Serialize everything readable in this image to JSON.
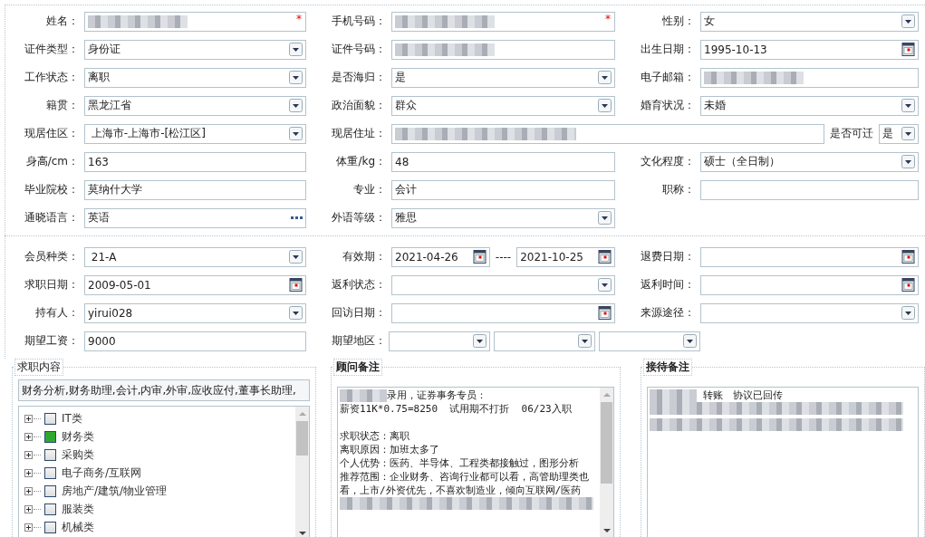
{
  "basic_info": {
    "rows": [
      [
        {
          "label": "姓名：",
          "control": {
            "kind": "text",
            "redacted": true,
            "required_mark": "*"
          }
        },
        {
          "label": "手机号码：",
          "control": {
            "kind": "text",
            "redacted": true,
            "required_mark": "*"
          }
        },
        {
          "label": "性别：",
          "control": {
            "kind": "select",
            "value": "女"
          }
        }
      ],
      [
        {
          "label": "证件类型：",
          "control": {
            "kind": "select",
            "value": "身份证"
          }
        },
        {
          "label": "证件号码：",
          "control": {
            "kind": "text",
            "redacted": true
          }
        },
        {
          "label": "出生日期：",
          "control": {
            "kind": "date",
            "value": "1995-10-13"
          }
        }
      ],
      [
        {
          "label": "工作状态：",
          "control": {
            "kind": "select",
            "value": "离职"
          }
        },
        {
          "label": "是否海归：",
          "control": {
            "kind": "select",
            "value": "是"
          }
        },
        {
          "label": "电子邮箱：",
          "control": {
            "kind": "text",
            "redacted": true
          }
        }
      ],
      [
        {
          "label": "籍贯：",
          "control": {
            "kind": "select",
            "value": "黑龙江省"
          }
        },
        {
          "label": "政治面貌：",
          "control": {
            "kind": "select",
            "value": "群众"
          }
        },
        {
          "label": "婚育状况：",
          "control": {
            "kind": "select",
            "value": "未婚"
          }
        }
      ],
      [
        {
          "label": "现居住区：",
          "control": {
            "kind": "select",
            "value": " 上海市-上海市-[松江区]"
          }
        },
        {
          "label": "现居住址：",
          "control": {
            "kind": "address",
            "redacted": true,
            "extra_label": "是否可迁",
            "extra_value": "是"
          }
        }
      ],
      [
        {
          "label": "身高/cm：",
          "control": {
            "kind": "text",
            "value": "163"
          }
        },
        {
          "label": "体重/kg：",
          "control": {
            "kind": "text",
            "value": "48"
          }
        },
        {
          "label": "文化程度：",
          "control": {
            "kind": "select",
            "value": "硕士（全日制）"
          }
        }
      ],
      [
        {
          "label": "毕业院校：",
          "control": {
            "kind": "text",
            "value": "莫纳什大学"
          }
        },
        {
          "label": "专业：",
          "control": {
            "kind": "text",
            "value": "会计"
          }
        },
        {
          "label": "职称：",
          "control": {
            "kind": "text"
          }
        }
      ],
      [
        {
          "label": "通晓语言：",
          "control": {
            "kind": "lookup",
            "value": "英语"
          }
        },
        {
          "label": "外语等级：",
          "control": {
            "kind": "select",
            "value": "雅思"
          }
        }
      ]
    ]
  },
  "membership": {
    "rows": [
      [
        {
          "label": "会员种类：",
          "control": {
            "kind": "select",
            "value": " 21-A"
          }
        },
        {
          "label": "有效期：",
          "control": {
            "kind": "date-range",
            "from": "2021-04-26",
            "separator": "----",
            "to": "2021-10-25"
          }
        },
        {
          "label": "退费日期：",
          "control": {
            "kind": "date"
          }
        }
      ],
      [
        {
          "label": "求职日期：",
          "control": {
            "kind": "date",
            "value": "2009-05-01"
          }
        },
        {
          "label": "返利状态：",
          "control": {
            "kind": "select"
          }
        },
        {
          "label": "返利时间：",
          "control": {
            "kind": "date"
          }
        }
      ],
      [
        {
          "label": "持有人：",
          "control": {
            "kind": "select",
            "value": "yirui028"
          }
        },
        {
          "label": "回访日期：",
          "control": {
            "kind": "date"
          }
        },
        {
          "label": "来源途径：",
          "control": {
            "kind": "select"
          }
        }
      ],
      [
        {
          "label": "期望工资：",
          "control": {
            "kind": "text",
            "value": "9000"
          }
        },
        {
          "label": "期望地区：",
          "control": {
            "kind": "select-group",
            "selects": [
              {
                "kind": "dropdown"
              },
              {
                "kind": "dropdown"
              },
              {
                "kind": "dropdown"
              }
            ]
          }
        }
      ]
    ]
  },
  "job_intention": {
    "legend": "求职内容",
    "summary": "财务分析,财务助理,会计,内审,外审,应收应付,董事长助理,",
    "categories": [
      {
        "label": "IT类",
        "checked": false
      },
      {
        "label": "财务类",
        "checked": true
      },
      {
        "label": "采购类",
        "checked": false
      },
      {
        "label": "电子商务/互联网",
        "checked": false
      },
      {
        "label": "房地产/建筑/物业管理",
        "checked": false
      },
      {
        "label": "服装类",
        "checked": false
      },
      {
        "label": "机械类",
        "checked": false
      }
    ]
  },
  "consultant_notes": {
    "legend": "顾问备注",
    "scrollbar": true,
    "lines": [
      {
        "kind": "line",
        "parts": [
          {
            "kind": "redacted"
          },
          {
            "kind": "text",
            "text": "录用，证券事务专员："
          }
        ]
      },
      {
        "kind": "line",
        "parts": [
          {
            "kind": "text",
            "text": "薪资11K*0.75=8250  试用期不打折  06/23入职"
          }
        ]
      },
      {
        "kind": "blank"
      },
      {
        "kind": "line",
        "parts": [
          {
            "kind": "text",
            "text": "求职状态：离职"
          }
        ]
      },
      {
        "kind": "line",
        "parts": [
          {
            "kind": "text",
            "text": "离职原因：加班太多了"
          }
        ]
      },
      {
        "kind": "line",
        "parts": [
          {
            "kind": "text",
            "text": "个人优势：医药、半导体、工程类都接触过，图形分析"
          }
        ]
      },
      {
        "kind": "line",
        "parts": [
          {
            "kind": "text",
            "text": "推荐范围：企业财务、咨询行业都可以看，高管助理类也看，上市/外资优先，不喜欢制造业，倾向互联网/医药"
          }
        ]
      },
      {
        "kind": "redacted-line"
      }
    ]
  },
  "reception_notes": {
    "legend": "接待备注",
    "scrollbar": false,
    "lines": [
      {
        "kind": "line",
        "parts": [
          {
            "kind": "redacted"
          },
          {
            "kind": "text",
            "text": " 转账　协议已回传"
          }
        ]
      },
      {
        "kind": "redacted-line"
      },
      {
        "kind": "redacted-line"
      }
    ]
  }
}
